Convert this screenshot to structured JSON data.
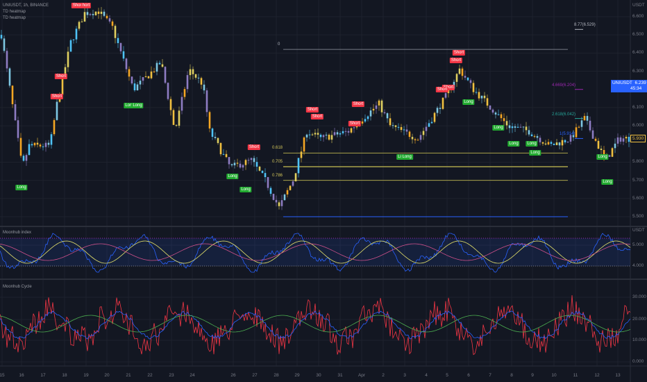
{
  "header": {
    "symbol_line": "UNIUSDT, 1h, BINANCE",
    "indicator1": "TD heatmap",
    "indicator2": "TD heatmap"
  },
  "panes": {
    "index_title": "Moonhub index",
    "cycle_title": "Moonhub Cycle"
  },
  "price_axis": {
    "currency": "USDT",
    "labels": [
      "6.600",
      "6.500",
      "6.400",
      "6.300",
      "6.100",
      "6.000",
      "5.800",
      "5.700",
      "5.600",
      "5.500"
    ],
    "values": [
      6.6,
      6.5,
      6.4,
      6.3,
      6.1,
      6.0,
      5.8,
      5.7,
      5.6,
      5.5
    ]
  },
  "index_axis": {
    "currency": "USDT",
    "labels": [
      "5.000",
      "4.000"
    ]
  },
  "cycle_axis": {
    "labels": [
      "30.000",
      "20.000",
      "10.000",
      "0.000"
    ]
  },
  "time_axis": [
    "15",
    "16",
    "17",
    "18",
    "19",
    "20",
    "21",
    "22",
    "23",
    "24",
    "26",
    "27",
    "28",
    "29",
    "30",
    "31",
    "Apr",
    "2",
    "3",
    "4",
    "5",
    "6",
    "7",
    "8",
    "9",
    "10",
    "11",
    "12",
    "13"
  ],
  "symbol_tag": {
    "symbol": "UNIUSDT",
    "price": "6.239",
    "countdown": "45:34",
    "color": "#2962ff"
  },
  "last_price_tag": {
    "price": "5.930",
    "color": "#f0c040"
  },
  "fib": {
    "retracement": [
      {
        "label": "0",
        "price": 6.42
      },
      {
        "label": "0.618",
        "price": 5.85
      },
      {
        "label": "0.705",
        "price": 5.775
      },
      {
        "label": "0.786",
        "price": 5.7
      },
      {
        "label": "",
        "price": 5.5
      }
    ],
    "extension": [
      {
        "label": "8.77(6.529)",
        "price": 6.53,
        "color": "#b2b5be"
      },
      {
        "label": "4.669(6.204)",
        "price": 6.2,
        "color": "#9c27b0"
      },
      {
        "label": "2.618(6.042)",
        "price": 6.04,
        "color": "#26a69a"
      },
      {
        "label": "1(5.914)",
        "price": 5.93,
        "color": "#2962ff"
      }
    ]
  },
  "signals": [
    {
      "text": "Short",
      "type": "short",
      "bar": 28,
      "price": 6.66
    },
    {
      "text": "hort",
      "type": "short",
      "bar": 31,
      "price": 6.66
    },
    {
      "text": "Short",
      "type": "short",
      "bar": 22,
      "price": 6.27
    },
    {
      "text": "Short",
      "type": "short",
      "bar": 20.5,
      "price": 6.16
    },
    {
      "text": "Long",
      "type": "long",
      "bar": 46.75,
      "price": 6.11
    },
    {
      "text": "Long",
      "type": "long",
      "bar": 49.5,
      "price": 6.11
    },
    {
      "text": "Long",
      "type": "long",
      "bar": 7.75,
      "price": 5.66
    },
    {
      "text": "Short",
      "type": "short",
      "bar": 91.5,
      "price": 5.88
    },
    {
      "text": "Long",
      "type": "long",
      "bar": 83.75,
      "price": 5.72
    },
    {
      "text": "Long",
      "type": "long",
      "bar": 88.5,
      "price": 5.65
    },
    {
      "text": "Short",
      "type": "short",
      "bar": 112.5,
      "price": 6.09
    },
    {
      "text": "Short",
      "type": "short",
      "bar": 114.25,
      "price": 6.05
    },
    {
      "text": "Short",
      "type": "short",
      "bar": 129,
      "price": 6.12
    },
    {
      "text": "Short",
      "type": "short",
      "bar": 127.75,
      "price": 6.01
    },
    {
      "text": "Li Long",
      "type": "long",
      "bar": 145.75,
      "price": 5.83
    },
    {
      "text": "Short",
      "type": "short",
      "bar": 165.25,
      "price": 6.4
    },
    {
      "text": "Short",
      "type": "short",
      "bar": 164.25,
      "price": 6.36
    },
    {
      "text": "Short",
      "type": "short",
      "bar": 161.5,
      "price": 6.21
    },
    {
      "text": "Short",
      "type": "short",
      "bar": 159.25,
      "price": 6.2
    },
    {
      "text": "Long",
      "type": "long",
      "bar": 168.75,
      "price": 6.13
    },
    {
      "text": "Long",
      "type": "long",
      "bar": 179.5,
      "price": 5.99
    },
    {
      "text": "Long",
      "type": "long",
      "bar": 185,
      "price": 5.9
    },
    {
      "text": "Long",
      "type": "long",
      "bar": 191.5,
      "price": 5.9
    },
    {
      "text": "Long",
      "type": "long",
      "bar": 192.75,
      "price": 5.85
    },
    {
      "text": "Long",
      "type": "long",
      "bar": 217,
      "price": 5.83
    },
    {
      "text": "Long",
      "type": "long",
      "bar": 218.75,
      "price": 5.69
    }
  ],
  "chart_data": {
    "type": "line",
    "title": "UNIUSDT, 1h, BINANCE",
    "ylim": [
      5.5,
      6.6
    ],
    "price_path": [
      [
        0,
        6.5
      ],
      [
        7.5,
        5.77
      ],
      [
        10,
        5.89
      ],
      [
        17.5,
        5.89
      ],
      [
        20,
        6.12
      ],
      [
        25,
        6.46
      ],
      [
        30,
        6.62
      ],
      [
        35,
        6.63
      ],
      [
        40,
        6.54
      ],
      [
        47.5,
        6.2
      ],
      [
        52.5,
        6.27
      ],
      [
        57.5,
        6.35
      ],
      [
        62.5,
        5.97
      ],
      [
        67.5,
        6.31
      ],
      [
        72.5,
        6.23
      ],
      [
        75,
        5.97
      ],
      [
        82.5,
        5.77
      ],
      [
        90,
        5.81
      ],
      [
        95,
        5.7
      ],
      [
        100,
        5.55
      ],
      [
        105,
        5.7
      ],
      [
        110,
        5.97
      ],
      [
        115,
        5.93
      ],
      [
        125,
        5.97
      ],
      [
        130,
        6.04
      ],
      [
        136,
        6.12
      ],
      [
        140,
        6.0
      ],
      [
        150,
        5.93
      ],
      [
        155,
        6.04
      ],
      [
        160,
        6.16
      ],
      [
        165,
        6.31
      ],
      [
        170,
        6.2
      ],
      [
        175,
        6.12
      ],
      [
        182.5,
        6.0
      ],
      [
        190,
        5.97
      ],
      [
        197.5,
        5.89
      ],
      [
        205,
        5.93
      ],
      [
        210,
        6.04
      ],
      [
        217.5,
        5.81
      ],
      [
        222.5,
        5.93
      ],
      [
        226,
        5.93
      ]
    ],
    "series": [
      {
        "name": "Moonhub index"
      },
      {
        "name": "Moonhub Cycle"
      }
    ]
  }
}
